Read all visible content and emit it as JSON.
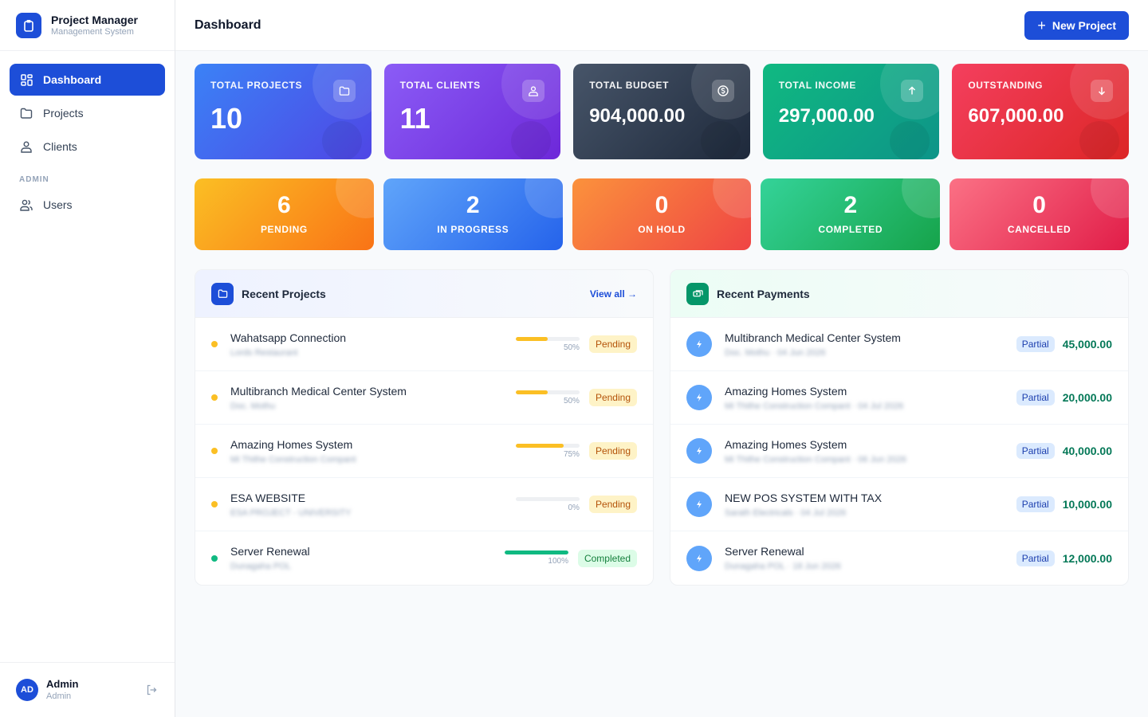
{
  "brand": {
    "title": "Project Manager",
    "subtitle": "Management System"
  },
  "sidebar": {
    "items": [
      {
        "label": "Dashboard",
        "icon": "grid-icon",
        "active": true
      },
      {
        "label": "Projects",
        "icon": "folder-icon"
      },
      {
        "label": "Clients",
        "icon": "clients-icon"
      }
    ],
    "section": "ADMIN",
    "admin_items": [
      {
        "label": "Users",
        "icon": "users-icon"
      }
    ]
  },
  "user": {
    "initials": "AD",
    "name": "Admin",
    "role": "Admin"
  },
  "header": {
    "title": "Dashboard",
    "new_button": "New Project"
  },
  "stats": [
    {
      "label": "TOTAL PROJECTS",
      "value": "10",
      "icon": "folder-icon",
      "color": "#4f46e5"
    },
    {
      "label": "TOTAL CLIENTS",
      "value": "11",
      "icon": "clients-icon",
      "color": "#7c3aed"
    },
    {
      "label": "TOTAL BUDGET",
      "value": "904,000.00",
      "icon": "dollar-icon",
      "color": "#334155"
    },
    {
      "label": "TOTAL INCOME",
      "value": "297,000.00",
      "icon": "arrow-up-icon",
      "color": "#10b981"
    },
    {
      "label": "OUTSTANDING",
      "value": "607,000.00",
      "icon": "arrow-down-icon",
      "color": "#e11d48"
    }
  ],
  "statuses": [
    {
      "count": "6",
      "label": "PENDING"
    },
    {
      "count": "2",
      "label": "IN PROGRESS"
    },
    {
      "count": "0",
      "label": "ON HOLD"
    },
    {
      "count": "2",
      "label": "COMPLETED"
    },
    {
      "count": "0",
      "label": "CANCELLED"
    }
  ],
  "recent_projects": {
    "title": "Recent Projects",
    "view_all": "View all →",
    "items": [
      {
        "name": "Wahatsapp Connection",
        "client": "Lords Restaurant",
        "progress": 50,
        "progress_label": "50%",
        "status": "Pending"
      },
      {
        "name": "Multibranch Medical Center System",
        "client": "Doc. Mothu",
        "progress": 50,
        "progress_label": "50%",
        "status": "Pending"
      },
      {
        "name": "Amazing Homes System",
        "client": "Mi Thithe Construction Compant",
        "progress": 75,
        "progress_label": "75%",
        "status": "Pending"
      },
      {
        "name": "ESA WEBSITE",
        "client": "ESA PROJECT - UNIVERSITY",
        "progress": 0,
        "progress_label": "0%",
        "status": "Pending"
      },
      {
        "name": "Server Renewal",
        "client": "Dunagaha POL",
        "progress": 100,
        "progress_label": "100%",
        "status": "Completed"
      }
    ]
  },
  "recent_payments": {
    "title": "Recent Payments",
    "items": [
      {
        "name": "Multibranch Medical Center System",
        "meta": "Doc. Mothu · 04 Jun 2026",
        "type": "Partial",
        "amount": "45,000.00"
      },
      {
        "name": "Amazing Homes System",
        "meta": "Mi Thithe Construction Compant · 04 Jul 2026",
        "type": "Partial",
        "amount": "20,000.00"
      },
      {
        "name": "Amazing Homes System",
        "meta": "Mi Thithe Construction Compant · 06 Jun 2026",
        "type": "Partial",
        "amount": "40,000.00"
      },
      {
        "name": "NEW POS SYSTEM WITH TAX",
        "meta": "Sarath Electricals · 04 Jul 2026",
        "type": "Partial",
        "amount": "10,000.00"
      },
      {
        "name": "Server Renewal",
        "meta": "Dunagaha POL · 18 Jun 2026",
        "type": "Partial",
        "amount": "12,000.00"
      }
    ]
  }
}
